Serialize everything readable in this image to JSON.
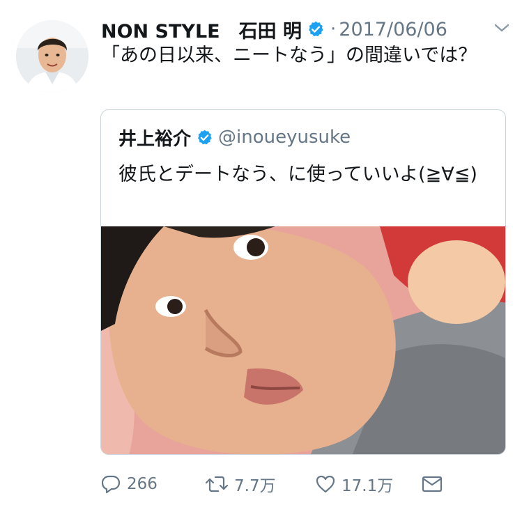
{
  "tweet": {
    "author_name": "NON STYLE　石田 明",
    "separator": "·",
    "date": "2017/06/06",
    "text": "「あの日以来、ニートなう」の間違いでは？"
  },
  "quoted": {
    "author_name": "井上裕介",
    "handle": "@inoueyusuke",
    "text": "彼氏とデートなう、に使っていいよ(≧∀≦)"
  },
  "actions": {
    "replies": "266",
    "retweets": "7.7万",
    "likes": "17.1万"
  },
  "colors": {
    "verified": "#1da1f2",
    "secondary_text": "#657786",
    "border": "#ccd6dd"
  },
  "icons": {
    "verified": "verified-badge-icon",
    "more": "chevron-down-icon",
    "reply": "reply-icon",
    "retweet": "retweet-icon",
    "like": "heart-icon",
    "dm": "envelope-icon"
  }
}
